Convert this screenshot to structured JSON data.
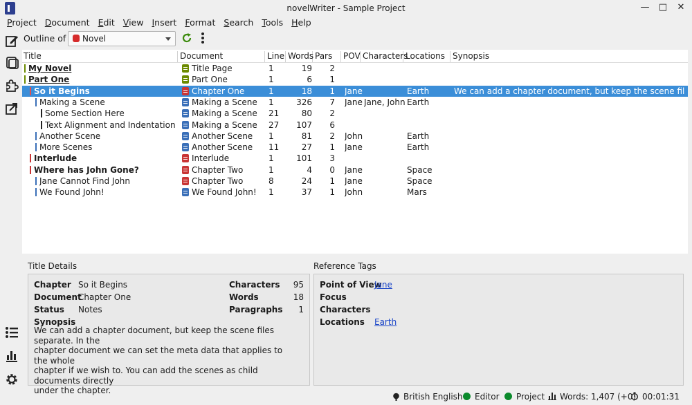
{
  "window": {
    "title": "novelWriter - Sample Project",
    "min": "—",
    "max": "□",
    "close": "✕"
  },
  "menu": [
    {
      "u": "P",
      "rest": "roject"
    },
    {
      "u": "D",
      "rest": "ocument"
    },
    {
      "u": "E",
      "rest": "dit"
    },
    {
      "u": "V",
      "rest": "iew"
    },
    {
      "u": "I",
      "rest": "nsert"
    },
    {
      "u": "F",
      "rest": "ormat"
    },
    {
      "u": "S",
      "rest": "earch"
    },
    {
      "u": "T",
      "rest": "ools"
    },
    {
      "u": "H",
      "rest": "elp"
    }
  ],
  "toolbar": {
    "outline_label": "Outline of",
    "root": "Novel"
  },
  "columns": [
    "Title",
    "Document",
    "Line",
    "Words",
    "Pars",
    "POV",
    "Characters",
    "Locations",
    "Synopsis"
  ],
  "rows": [
    {
      "title": "My Novel",
      "level": 0,
      "bar": "#6b8a00",
      "bold": true,
      "ul": true,
      "doc": "Title Page",
      "doc_color": "#6b8a00",
      "line": "1",
      "words": "19",
      "pars": "2",
      "pov": "",
      "chars": "",
      "locs": "",
      "syn": ""
    },
    {
      "title": "Part One",
      "level": 0,
      "bar": "#6b8a00",
      "bold": true,
      "ul": true,
      "doc": "Part One",
      "doc_color": "#6b8a00",
      "line": "1",
      "words": "6",
      "pars": "1",
      "pov": "",
      "chars": "",
      "locs": "",
      "syn": ""
    },
    {
      "title": "So it Begins",
      "level": 1,
      "bar": "#e05050",
      "bold": true,
      "sel": true,
      "doc": "Chapter One",
      "doc_color": "#c93535",
      "line": "1",
      "words": "18",
      "pars": "1",
      "pov": "Jane",
      "chars": "",
      "locs": "Earth",
      "syn": "We can add a chapter document, but keep the scene files separ..."
    },
    {
      "title": "Making a Scene",
      "level": 2,
      "bar": "#3a6fb8",
      "doc": "Making a Scene",
      "doc_color": "#3a6fb8",
      "line": "1",
      "words": "326",
      "pars": "7",
      "pov": "Jane",
      "chars": "Jane, John",
      "locs": "Earth",
      "syn": ""
    },
    {
      "title": "Some Section Here",
      "level": 3,
      "bar": "#222222",
      "doc": "Making a Scene",
      "doc_color": "#3a6fb8",
      "line": "21",
      "words": "80",
      "pars": "2",
      "pov": "",
      "chars": "",
      "locs": "",
      "syn": ""
    },
    {
      "title": "Text Alignment and Indentation",
      "level": 3,
      "bar": "#222222",
      "doc": "Making a Scene",
      "doc_color": "#3a6fb8",
      "line": "27",
      "words": "107",
      "pars": "6",
      "pov": "",
      "chars": "",
      "locs": "",
      "syn": ""
    },
    {
      "title": "Another Scene",
      "level": 2,
      "bar": "#3a6fb8",
      "doc": "Another Scene",
      "doc_color": "#3a6fb8",
      "line": "1",
      "words": "81",
      "pars": "2",
      "pov": "John",
      "chars": "",
      "locs": "Earth",
      "syn": ""
    },
    {
      "title": "More Scenes",
      "level": 2,
      "bar": "#3a6fb8",
      "doc": "Another Scene",
      "doc_color": "#3a6fb8",
      "line": "11",
      "words": "27",
      "pars": "1",
      "pov": "Jane",
      "chars": "",
      "locs": "Earth",
      "syn": ""
    },
    {
      "title": "Interlude",
      "level": 1,
      "bar": "#c93535",
      "bold": true,
      "doc": "Interlude",
      "doc_color": "#c93535",
      "line": "1",
      "words": "101",
      "pars": "3",
      "pov": "",
      "chars": "",
      "locs": "",
      "syn": ""
    },
    {
      "title": "Where has John Gone?",
      "level": 1,
      "bar": "#c93535",
      "bold": true,
      "doc": "Chapter Two",
      "doc_color": "#c93535",
      "line": "1",
      "words": "4",
      "pars": "0",
      "pov": "Jane",
      "chars": "",
      "locs": "Space",
      "syn": ""
    },
    {
      "title": "Jane Cannot Find John",
      "level": 2,
      "bar": "#3a6fb8",
      "doc": "Chapter Two",
      "doc_color": "#c93535",
      "line": "8",
      "words": "24",
      "pars": "1",
      "pov": "Jane",
      "chars": "",
      "locs": "Space",
      "syn": ""
    },
    {
      "title": "We Found John!",
      "level": 2,
      "bar": "#3a6fb8",
      "doc": "We Found John!",
      "doc_color": "#3a6fb8",
      "line": "1",
      "words": "37",
      "pars": "1",
      "pov": "John",
      "chars": "",
      "locs": "Mars",
      "syn": ""
    }
  ],
  "details": {
    "label": "Title Details",
    "chapter_k": "Chapter",
    "chapter_v": "So it Begins",
    "document_k": "Document",
    "document_v": "Chapter One",
    "status_k": "Status",
    "status_v": "Notes",
    "characters_k": "Characters",
    "characters_v": "95",
    "words_k": "Words",
    "words_v": "18",
    "paragraphs_k": "Paragraphs",
    "paragraphs_v": "1",
    "synopsis_k": "Synopsis",
    "synopsis_lines": [
      "We can add a chapter document, but keep the scene files separate. In the",
      "chapter document we can set the meta data that applies to the whole",
      "chapter if we wish to. You can add the scenes as child documents directly",
      "under the chapter."
    ]
  },
  "refs": {
    "label": "Reference Tags",
    "pov_k": "Point of View",
    "pov_v": "Jane",
    "focus_k": "Focus",
    "chars_k": "Characters",
    "locs_k": "Locations",
    "locs_v": "Earth"
  },
  "status": {
    "language": "British English",
    "editor": "Editor",
    "project": "Project",
    "words": "Words: 1,407 (+0)",
    "time": "00:01:31"
  }
}
